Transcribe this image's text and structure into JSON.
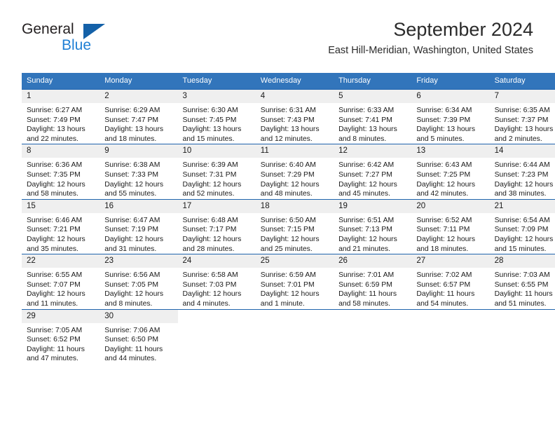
{
  "brand": {
    "name_part1": "General",
    "name_part2": "Blue",
    "logo_icon": "triangle-logo-icon",
    "color_dark": "#231f20",
    "color_blue": "#1f7fd4",
    "color_triangle": "#1461a8"
  },
  "header": {
    "month_title": "September 2024",
    "location": "East Hill-Meridian, Washington, United States"
  },
  "theme": {
    "header_bg": "#3275bb",
    "row_divider": "#1f64ad",
    "daynum_band_bg": "#efefef",
    "text": "#1a1a1a"
  },
  "weekdays": [
    "Sunday",
    "Monday",
    "Tuesday",
    "Wednesday",
    "Thursday",
    "Friday",
    "Saturday"
  ],
  "weeks": [
    {
      "days": [
        {
          "day": "1",
          "sunrise": "Sunrise: 6:27 AM",
          "sunset": "Sunset: 7:49 PM",
          "daylight_line1": "Daylight: 13 hours",
          "daylight_line2": "and 22 minutes."
        },
        {
          "day": "2",
          "sunrise": "Sunrise: 6:29 AM",
          "sunset": "Sunset: 7:47 PM",
          "daylight_line1": "Daylight: 13 hours",
          "daylight_line2": "and 18 minutes."
        },
        {
          "day": "3",
          "sunrise": "Sunrise: 6:30 AM",
          "sunset": "Sunset: 7:45 PM",
          "daylight_line1": "Daylight: 13 hours",
          "daylight_line2": "and 15 minutes."
        },
        {
          "day": "4",
          "sunrise": "Sunrise: 6:31 AM",
          "sunset": "Sunset: 7:43 PM",
          "daylight_line1": "Daylight: 13 hours",
          "daylight_line2": "and 12 minutes."
        },
        {
          "day": "5",
          "sunrise": "Sunrise: 6:33 AM",
          "sunset": "Sunset: 7:41 PM",
          "daylight_line1": "Daylight: 13 hours",
          "daylight_line2": "and 8 minutes."
        },
        {
          "day": "6",
          "sunrise": "Sunrise: 6:34 AM",
          "sunset": "Sunset: 7:39 PM",
          "daylight_line1": "Daylight: 13 hours",
          "daylight_line2": "and 5 minutes."
        },
        {
          "day": "7",
          "sunrise": "Sunrise: 6:35 AM",
          "sunset": "Sunset: 7:37 PM",
          "daylight_line1": "Daylight: 13 hours",
          "daylight_line2": "and 2 minutes."
        }
      ]
    },
    {
      "days": [
        {
          "day": "8",
          "sunrise": "Sunrise: 6:36 AM",
          "sunset": "Sunset: 7:35 PM",
          "daylight_line1": "Daylight: 12 hours",
          "daylight_line2": "and 58 minutes."
        },
        {
          "day": "9",
          "sunrise": "Sunrise: 6:38 AM",
          "sunset": "Sunset: 7:33 PM",
          "daylight_line1": "Daylight: 12 hours",
          "daylight_line2": "and 55 minutes."
        },
        {
          "day": "10",
          "sunrise": "Sunrise: 6:39 AM",
          "sunset": "Sunset: 7:31 PM",
          "daylight_line1": "Daylight: 12 hours",
          "daylight_line2": "and 52 minutes."
        },
        {
          "day": "11",
          "sunrise": "Sunrise: 6:40 AM",
          "sunset": "Sunset: 7:29 PM",
          "daylight_line1": "Daylight: 12 hours",
          "daylight_line2": "and 48 minutes."
        },
        {
          "day": "12",
          "sunrise": "Sunrise: 6:42 AM",
          "sunset": "Sunset: 7:27 PM",
          "daylight_line1": "Daylight: 12 hours",
          "daylight_line2": "and 45 minutes."
        },
        {
          "day": "13",
          "sunrise": "Sunrise: 6:43 AM",
          "sunset": "Sunset: 7:25 PM",
          "daylight_line1": "Daylight: 12 hours",
          "daylight_line2": "and 42 minutes."
        },
        {
          "day": "14",
          "sunrise": "Sunrise: 6:44 AM",
          "sunset": "Sunset: 7:23 PM",
          "daylight_line1": "Daylight: 12 hours",
          "daylight_line2": "and 38 minutes."
        }
      ]
    },
    {
      "days": [
        {
          "day": "15",
          "sunrise": "Sunrise: 6:46 AM",
          "sunset": "Sunset: 7:21 PM",
          "daylight_line1": "Daylight: 12 hours",
          "daylight_line2": "and 35 minutes."
        },
        {
          "day": "16",
          "sunrise": "Sunrise: 6:47 AM",
          "sunset": "Sunset: 7:19 PM",
          "daylight_line1": "Daylight: 12 hours",
          "daylight_line2": "and 31 minutes."
        },
        {
          "day": "17",
          "sunrise": "Sunrise: 6:48 AM",
          "sunset": "Sunset: 7:17 PM",
          "daylight_line1": "Daylight: 12 hours",
          "daylight_line2": "and 28 minutes."
        },
        {
          "day": "18",
          "sunrise": "Sunrise: 6:50 AM",
          "sunset": "Sunset: 7:15 PM",
          "daylight_line1": "Daylight: 12 hours",
          "daylight_line2": "and 25 minutes."
        },
        {
          "day": "19",
          "sunrise": "Sunrise: 6:51 AM",
          "sunset": "Sunset: 7:13 PM",
          "daylight_line1": "Daylight: 12 hours",
          "daylight_line2": "and 21 minutes."
        },
        {
          "day": "20",
          "sunrise": "Sunrise: 6:52 AM",
          "sunset": "Sunset: 7:11 PM",
          "daylight_line1": "Daylight: 12 hours",
          "daylight_line2": "and 18 minutes."
        },
        {
          "day": "21",
          "sunrise": "Sunrise: 6:54 AM",
          "sunset": "Sunset: 7:09 PM",
          "daylight_line1": "Daylight: 12 hours",
          "daylight_line2": "and 15 minutes."
        }
      ]
    },
    {
      "days": [
        {
          "day": "22",
          "sunrise": "Sunrise: 6:55 AM",
          "sunset": "Sunset: 7:07 PM",
          "daylight_line1": "Daylight: 12 hours",
          "daylight_line2": "and 11 minutes."
        },
        {
          "day": "23",
          "sunrise": "Sunrise: 6:56 AM",
          "sunset": "Sunset: 7:05 PM",
          "daylight_line1": "Daylight: 12 hours",
          "daylight_line2": "and 8 minutes."
        },
        {
          "day": "24",
          "sunrise": "Sunrise: 6:58 AM",
          "sunset": "Sunset: 7:03 PM",
          "daylight_line1": "Daylight: 12 hours",
          "daylight_line2": "and 4 minutes."
        },
        {
          "day": "25",
          "sunrise": "Sunrise: 6:59 AM",
          "sunset": "Sunset: 7:01 PM",
          "daylight_line1": "Daylight: 12 hours",
          "daylight_line2": "and 1 minute."
        },
        {
          "day": "26",
          "sunrise": "Sunrise: 7:01 AM",
          "sunset": "Sunset: 6:59 PM",
          "daylight_line1": "Daylight: 11 hours",
          "daylight_line2": "and 58 minutes."
        },
        {
          "day": "27",
          "sunrise": "Sunrise: 7:02 AM",
          "sunset": "Sunset: 6:57 PM",
          "daylight_line1": "Daylight: 11 hours",
          "daylight_line2": "and 54 minutes."
        },
        {
          "day": "28",
          "sunrise": "Sunrise: 7:03 AM",
          "sunset": "Sunset: 6:55 PM",
          "daylight_line1": "Daylight: 11 hours",
          "daylight_line2": "and 51 minutes."
        }
      ]
    },
    {
      "days": [
        {
          "day": "29",
          "sunrise": "Sunrise: 7:05 AM",
          "sunset": "Sunset: 6:52 PM",
          "daylight_line1": "Daylight: 11 hours",
          "daylight_line2": "and 47 minutes."
        },
        {
          "day": "30",
          "sunrise": "Sunrise: 7:06 AM",
          "sunset": "Sunset: 6:50 PM",
          "daylight_line1": "Daylight: 11 hours",
          "daylight_line2": "and 44 minutes."
        },
        {
          "day": "",
          "sunrise": "",
          "sunset": "",
          "daylight_line1": "",
          "daylight_line2": ""
        },
        {
          "day": "",
          "sunrise": "",
          "sunset": "",
          "daylight_line1": "",
          "daylight_line2": ""
        },
        {
          "day": "",
          "sunrise": "",
          "sunset": "",
          "daylight_line1": "",
          "daylight_line2": ""
        },
        {
          "day": "",
          "sunrise": "",
          "sunset": "",
          "daylight_line1": "",
          "daylight_line2": ""
        },
        {
          "day": "",
          "sunrise": "",
          "sunset": "",
          "daylight_line1": "",
          "daylight_line2": ""
        }
      ]
    }
  ]
}
